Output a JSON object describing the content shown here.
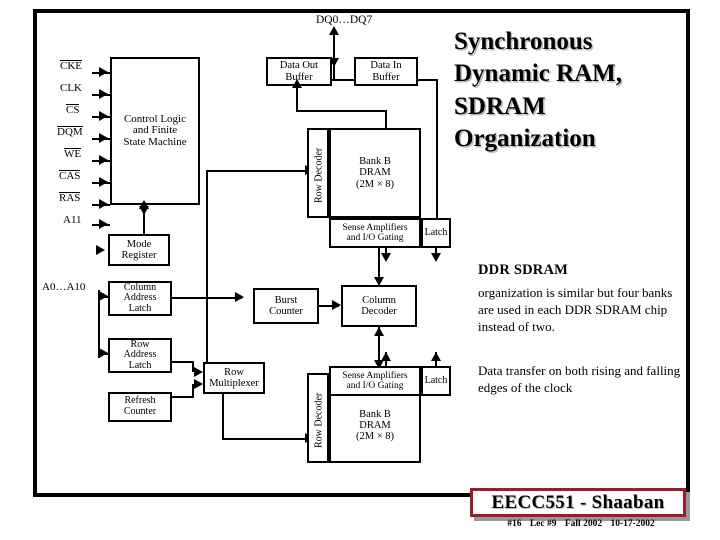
{
  "slide": {
    "title": "Synchronous Dynamic RAM, SDRAM Organization",
    "title_lines": [
      "Synchronous",
      "Dynamic RAM,",
      "SDRAM",
      "Organization"
    ],
    "accent_color": "#9c1c2e",
    "shadow_color": "#b9b9b9"
  },
  "notes": {
    "ddr_heading": "DDR SDRAM",
    "paragraph1": "organization is similar but four banks are used in each DDR SDRAM chip instead of two.",
    "paragraph2": "Data transfer on both rising and falling edges of the clock"
  },
  "footer": {
    "course": "EECC551 - Shaaban",
    "slide_number": "#16",
    "lecture": "Lec #9",
    "term": "Fall 2002",
    "date": "10-17-2002"
  },
  "diagram": {
    "data_bus_label": "DQ0…DQ7",
    "address_bus_label": "A0…A10",
    "control_signals": [
      {
        "name": "CKE",
        "overline": true
      },
      {
        "name": "CLK",
        "overline": false
      },
      {
        "name": "CS",
        "overline": true
      },
      {
        "name": "DQM",
        "overline": true
      },
      {
        "name": "WE",
        "overline": true
      },
      {
        "name": "CAS",
        "overline": true
      },
      {
        "name": "RAS",
        "overline": true
      },
      {
        "name": "A11",
        "overline": false
      }
    ],
    "blocks": {
      "control_logic": {
        "lines": [
          "Control Logic",
          "and Finite",
          "State Machine"
        ]
      },
      "data_out_buffer": {
        "lines": [
          "Data Out",
          "Buffer"
        ]
      },
      "data_in_buffer": {
        "lines": [
          "Data In",
          "Buffer"
        ]
      },
      "mode_register": {
        "lines": [
          "Mode",
          "Register"
        ]
      },
      "column_address_latch": {
        "lines": [
          "Column",
          "Address",
          "Latch"
        ]
      },
      "row_address_latch": {
        "lines": [
          "Row",
          "Address",
          "Latch"
        ]
      },
      "refresh_counter": {
        "lines": [
          "Refresh",
          "Counter"
        ]
      },
      "row_multiplexer": {
        "lines": [
          "Row",
          "Multiplexer"
        ]
      },
      "burst_counter": {
        "lines": [
          "Burst",
          "Counter"
        ]
      },
      "column_decoder": {
        "lines": [
          "Column",
          "Decoder"
        ]
      },
      "row_decoder_top": {
        "label": "Row Decoder"
      },
      "row_decoder_bottom": {
        "label": "Row Decoder"
      },
      "bank_top": {
        "lines": [
          "Bank B",
          "DRAM",
          "(2M × 8)"
        ]
      },
      "bank_bottom": {
        "lines": [
          "Bank B",
          "DRAM",
          "(2M × 8)"
        ]
      },
      "sense_amp_top": {
        "lines": [
          "Sense Amplifiers",
          "and I/O Gating"
        ]
      },
      "sense_amp_bottom": {
        "lines": [
          "Sense Amplifiers",
          "and I/O Gating"
        ]
      },
      "latch_top": {
        "label": "Latch"
      },
      "latch_bottom": {
        "label": "Latch"
      }
    }
  }
}
